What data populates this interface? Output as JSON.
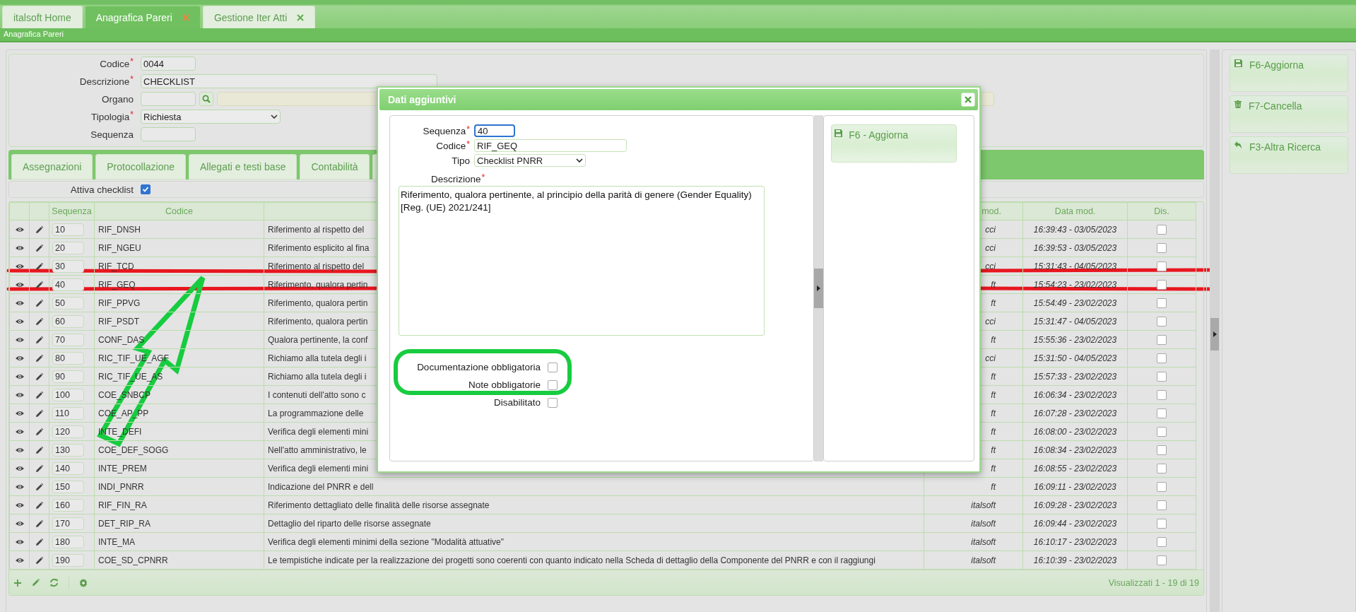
{
  "app_tabs": [
    {
      "label": "italsoft Home",
      "selected": false,
      "closable": false
    },
    {
      "label": "Anagrafica Pareri",
      "selected": true,
      "closable": true
    },
    {
      "label": "Gestione Iter Atti",
      "selected": false,
      "closable": true
    }
  ],
  "breadcrumb": "Anagrafica Pareri",
  "form": {
    "fields": [
      {
        "label": "Codice",
        "required_mark": "*",
        "kind": "short",
        "value": "0044"
      },
      {
        "label": "Descrizione",
        "required_mark": "*",
        "kind": "long",
        "value": "CHECKLIST"
      },
      {
        "label": "Organo",
        "kind": "lookup"
      },
      {
        "label": "Tipologia",
        "required_mark": "*",
        "kind": "select",
        "value": "Richiesta"
      },
      {
        "label": "Sequenza",
        "kind": "short"
      }
    ]
  },
  "section_tabs": [
    {
      "label": "Assegnazioni",
      "selected": false
    },
    {
      "label": "Protocollazione",
      "selected": false
    },
    {
      "label": "Allegati e testi base",
      "selected": false
    },
    {
      "label": "Contabilità",
      "selected": false
    }
  ],
  "attiva_checklist": {
    "label": "Attiva checklist",
    "checked": true
  },
  "table": {
    "columns": {
      "sequenza": "Sequenza",
      "codice": "Codice",
      "column_6": "mod.",
      "data_mod": "Data mod.",
      "dis": "Dis."
    },
    "rows": [
      {
        "sequenza": "10",
        "codice": "RIF_DNSH",
        "descrizione": "Riferimento al rispetto del",
        "column_6": "cci",
        "data_mod": "16:39:43 - 03/05/2023",
        "dis": false
      },
      {
        "sequenza": "20",
        "codice": "RIF_NGEU",
        "descrizione": "Riferimento esplicito al fina",
        "column_6": "cci",
        "data_mod": "16:39:53 - 03/05/2023",
        "dis": false
      },
      {
        "sequenza": "30",
        "codice": "RIF_TCD",
        "descrizione": "Riferimento al rispetto del",
        "column_6": "cci",
        "data_mod": "15:31:43 - 04/05/2023",
        "dis": false
      },
      {
        "sequenza": "40",
        "codice": "RIF_GEQ",
        "descrizione": "Riferimento, qualora pertin",
        "column_6": "ft",
        "data_mod": "15:54:23 - 23/02/2023",
        "dis": false
      },
      {
        "sequenza": "50",
        "codice": "RIF_PPVG",
        "descrizione": "Riferimento, qualora pertin",
        "column_6": "ft",
        "data_mod": "15:54:49 - 23/02/2023",
        "dis": false
      },
      {
        "sequenza": "60",
        "codice": "RIF_PSDT",
        "descrizione": "Riferimento, qualora pertin",
        "column_6": "cci",
        "data_mod": "15:31:47 - 04/05/2023",
        "dis": false
      },
      {
        "sequenza": "70",
        "codice": "CONF_DAS",
        "descrizione": "Qualora pertinente, la conf",
        "column_6": "ft",
        "data_mod": "15:55:36 - 23/02/2023",
        "dis": false
      },
      {
        "sequenza": "80",
        "codice": "RIC_TIF_UE_AGF",
        "descrizione": "Richiamo alla tutela degli i",
        "column_6": "cci",
        "data_mod": "15:31:50 - 04/05/2023",
        "dis": false
      },
      {
        "sequenza": "90",
        "codice": "RIC_TIF_UE_AS",
        "descrizione": "Richiamo alla tutela degli i",
        "column_6": "ft",
        "data_mod": "15:57:33 - 23/02/2023",
        "dis": false
      },
      {
        "sequenza": "100",
        "codice": "COE_SNBCP",
        "descrizione": "I contenuti dell'atto sono c",
        "column_6": "ft",
        "data_mod": "16:06:34 - 23/02/2023",
        "dis": false
      },
      {
        "sequenza": "110",
        "codice": "COE_AP_PP",
        "descrizione": "La programmazione delle",
        "column_6": "ft",
        "data_mod": "16:07:28 - 23/02/2023",
        "dis": false
      },
      {
        "sequenza": "120",
        "codice": "INTE_DEFI",
        "descrizione": "Verifica degli elementi mini",
        "column_6": "ft",
        "data_mod": "16:08:00 - 23/02/2023",
        "dis": false
      },
      {
        "sequenza": "130",
        "codice": "COE_DEF_SOGG",
        "descrizione": "Nell'atto amministrativo, le",
        "column_6": "ft",
        "data_mod": "16:08:34 - 23/02/2023",
        "dis": false
      },
      {
        "sequenza": "140",
        "codice": "INTE_PREM",
        "descrizione": "Verifica degli elementi mini",
        "column_6": "ft",
        "data_mod": "16:08:55 - 23/02/2023",
        "dis": false
      },
      {
        "sequenza": "150",
        "codice": "INDI_PNRR",
        "descrizione": "Indicazione del PNRR e dell",
        "column_6": "ft",
        "data_mod": "16:09:11 - 23/02/2023",
        "dis": false
      },
      {
        "sequenza": "160",
        "codice": "RIF_FIN_RA",
        "descrizione": "Riferimento dettagliato delle finalità delle risorse assegnate",
        "column_6": "italsoft",
        "data_mod": "16:09:28 - 23/02/2023",
        "dis": false
      },
      {
        "sequenza": "170",
        "codice": "DET_RIP_RA",
        "descrizione": "Dettaglio del riparto delle risorse assegnate",
        "column_6": "italsoft",
        "data_mod": "16:09:44 - 23/02/2023",
        "dis": false
      },
      {
        "sequenza": "180",
        "codice": "INTE_MA",
        "descrizione": "Verifica degli elementi minimi della sezione \"Modalità attuative\"",
        "column_6": "italsoft",
        "data_mod": "16:10:17 - 23/02/2023",
        "dis": false
      },
      {
        "sequenza": "190",
        "codice": "COE_SD_CPNRR",
        "descrizione": "Le tempistiche indicate per la realizzazione dei progetti sono coerenti con quanto indicato nella Scheda di dettaglio della Componente del PNRR e con il raggiungi",
        "column_6": "italsoft",
        "data_mod": "16:10:39 - 23/02/2023",
        "dis": false
      }
    ],
    "footer": "Visualizzati 1 - 19 di 19"
  },
  "side_actions": [
    {
      "label": "F6-Aggiorna",
      "kind": "save"
    },
    {
      "label": "F7-Cancella",
      "kind": "delete"
    },
    {
      "label": "F3-Altra Ricerca",
      "kind": "back"
    }
  ],
  "dialog": {
    "title": "Dati aggiuntivi",
    "fields": [
      {
        "label": "Sequenza",
        "required_mark": "*",
        "kind": "short",
        "value": "40",
        "focused": true
      },
      {
        "label": "Codice",
        "required_mark": "*",
        "kind": "text",
        "value": "RIF_GEQ",
        "focused": false
      },
      {
        "label": "Tipo",
        "kind": "select",
        "value": "Checklist PNRR",
        "focused": false
      }
    ],
    "descrizione": {
      "label": "Descrizione",
      "required_mark": "*",
      "value": "Riferimento, qualora pertinente, al principio della parità di genere (Gender Equality) [Reg. (UE) 2021/241]"
    },
    "checkboxes": [
      {
        "label": "Documentazione obbligatoria",
        "checked": false
      },
      {
        "label": "Note obbligatorie",
        "checked": false
      },
      {
        "label": "Disabilitato",
        "checked": false
      }
    ],
    "actions": [
      {
        "label": "F6 - Aggiorna",
        "kind": "save"
      }
    ]
  },
  "annotations": [
    {
      "kind": "line",
      "color": "#e8161f"
    },
    {
      "kind": "line",
      "color": "#e8161f"
    },
    {
      "kind": "arrow",
      "color": "#17cc3f"
    },
    {
      "kind": "ring",
      "color": "#17cc3f"
    }
  ]
}
